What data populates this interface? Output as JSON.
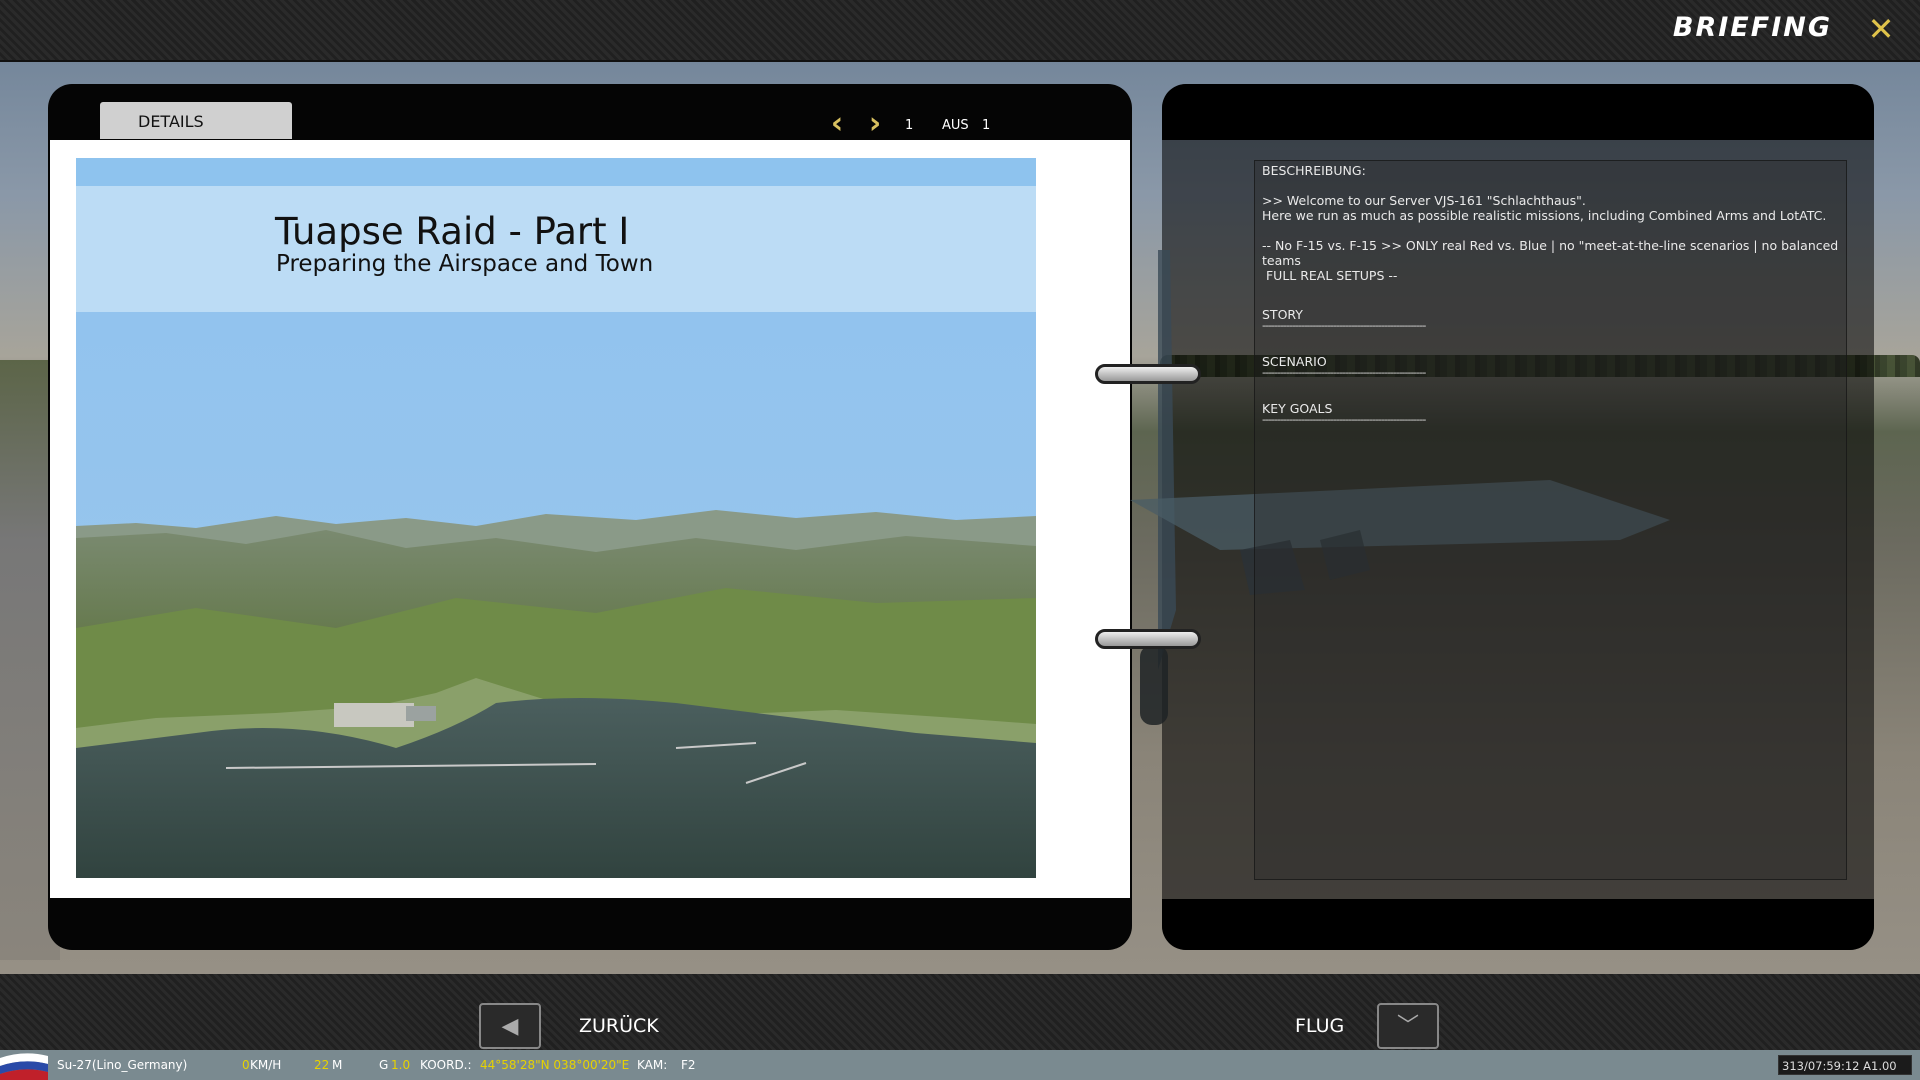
{
  "header": {
    "title": "BRIEFING",
    "close_icon": "close-icon"
  },
  "left_page": {
    "tab_label": "DETAILS",
    "pager": {
      "current": "1",
      "of_label": "AUS",
      "total": "1"
    },
    "image": {
      "title": "Tuapse Raid - Part I",
      "subtitle": "Preparing the Airspace and Town"
    }
  },
  "right_page": {
    "description_label": "BESCHREIBUNG:",
    "description_lines": [
      ">> Welcome to our Server VJS-161 \"Schlachthaus\".",
      "Here we run as much as possible realistic missions, including Combined Arms and LotATC.",
      "-- No F-15 vs. F-15 >> ONLY real Red vs. Blue | no \"meet-at-the-line scenarios | no balanced teams",
      " FULL REAL SETUPS --"
    ],
    "story_label": "STORY",
    "scenario_label": "SCENARIO",
    "key_goals_label": "KEY GOALS",
    "separator": "-------------------------------------------------------"
  },
  "nav": {
    "back_label": "ZURÜCK",
    "fly_label": "FLUG"
  },
  "status": {
    "unit": "Su-27(Lino_Germany)",
    "speed_value": "0",
    "speed_unit": "KM/H",
    "alt_value": "22",
    "alt_unit": "M",
    "g_label": "G",
    "g_value": "1.0",
    "coord_label": "KOORD.:",
    "coord_value": "44°58'28\"N 038°00'20\"E",
    "cam_label": "KAM:",
    "cam_value": "F2",
    "clock": "313/07:59:12 A1.00"
  },
  "colors": {
    "accent": "#d8c060",
    "status_value": "#e6d200"
  }
}
